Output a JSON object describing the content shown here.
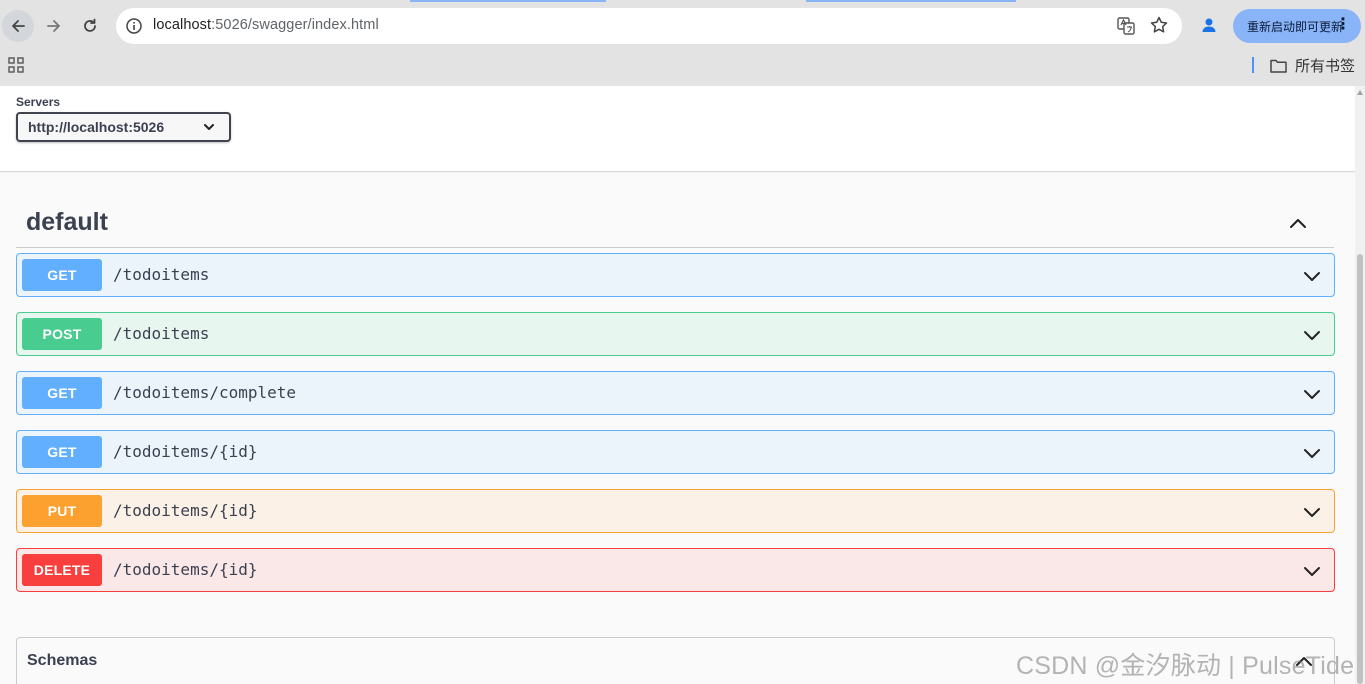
{
  "browser": {
    "url_host": "localhost",
    "url_rest": ":5026/swagger/index.html",
    "update_button": "重新启动即可更新",
    "bookmarks_all": "所有书签"
  },
  "servers": {
    "label": "Servers",
    "selected": "http://localhost:5026"
  },
  "tag": {
    "name": "default"
  },
  "operations": [
    {
      "method": "GET",
      "path": "/todoitems"
    },
    {
      "method": "POST",
      "path": "/todoitems"
    },
    {
      "method": "GET",
      "path": "/todoitems/complete"
    },
    {
      "method": "GET",
      "path": "/todoitems/{id}"
    },
    {
      "method": "PUT",
      "path": "/todoitems/{id}"
    },
    {
      "method": "DELETE",
      "path": "/todoitems/{id}"
    }
  ],
  "schemas": {
    "title": "Schemas"
  },
  "watermark": "CSDN @金汐脉动 | PulseTide",
  "colors": {
    "get": "#61affe",
    "post": "#49cc90",
    "put": "#fca130",
    "delete": "#f93e3e",
    "text": "#3b4151"
  }
}
